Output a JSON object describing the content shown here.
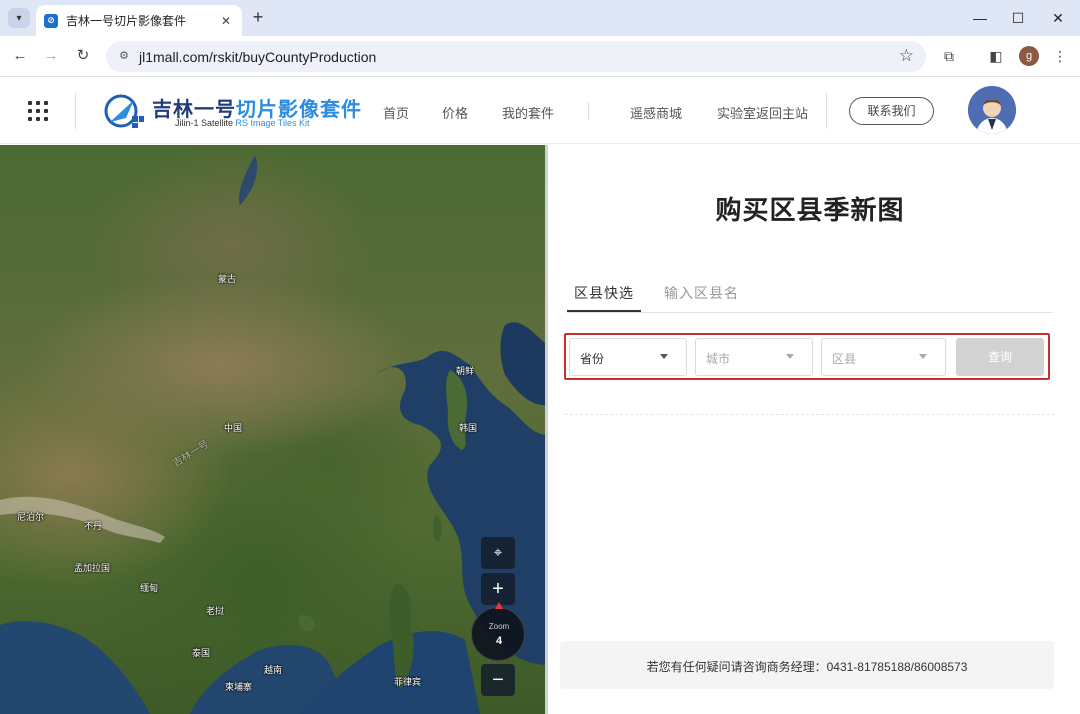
{
  "browser": {
    "tab_title": "吉林一号切片影像套件",
    "favicon_glyph": "⊘",
    "url": "jl1mall.com/rskit/buyCountyProduction",
    "profile_initial": "g"
  },
  "header": {
    "logo_title_main": "吉林一号",
    "logo_title_accent": "切片影像套件",
    "logo_sub_main": "Jilin-1  Satellite ",
    "logo_sub_accent": "RS Image Tiles Kit",
    "nav": [
      "首页",
      "价格",
      "我的套件",
      "遥感商城",
      "实验室返回主站"
    ],
    "contact_label": "联系我们"
  },
  "map": {
    "labels": [
      "蒙古",
      "朝鲜",
      "中国",
      "韩国",
      "尼泊尔",
      "不丹",
      "孟加拉国",
      "缅甸",
      "老挝",
      "泰国",
      "越南",
      "柬埔寨",
      "菲律宾"
    ],
    "watermark": "吉林一号",
    "zoom_label": "Zoom",
    "zoom_value": "4",
    "zoom_in_glyph": "+",
    "zoom_out_glyph": "−"
  },
  "panel": {
    "title": "购买区县季新图",
    "tabs": [
      "区县快选",
      "输入区县名"
    ],
    "province_value": "省份",
    "city_placeholder": "城市",
    "county_placeholder": "区县",
    "query_label": "查询",
    "footer_text": "若您有任何疑问请咨询商务经理：0431-81785188/86008573"
  }
}
